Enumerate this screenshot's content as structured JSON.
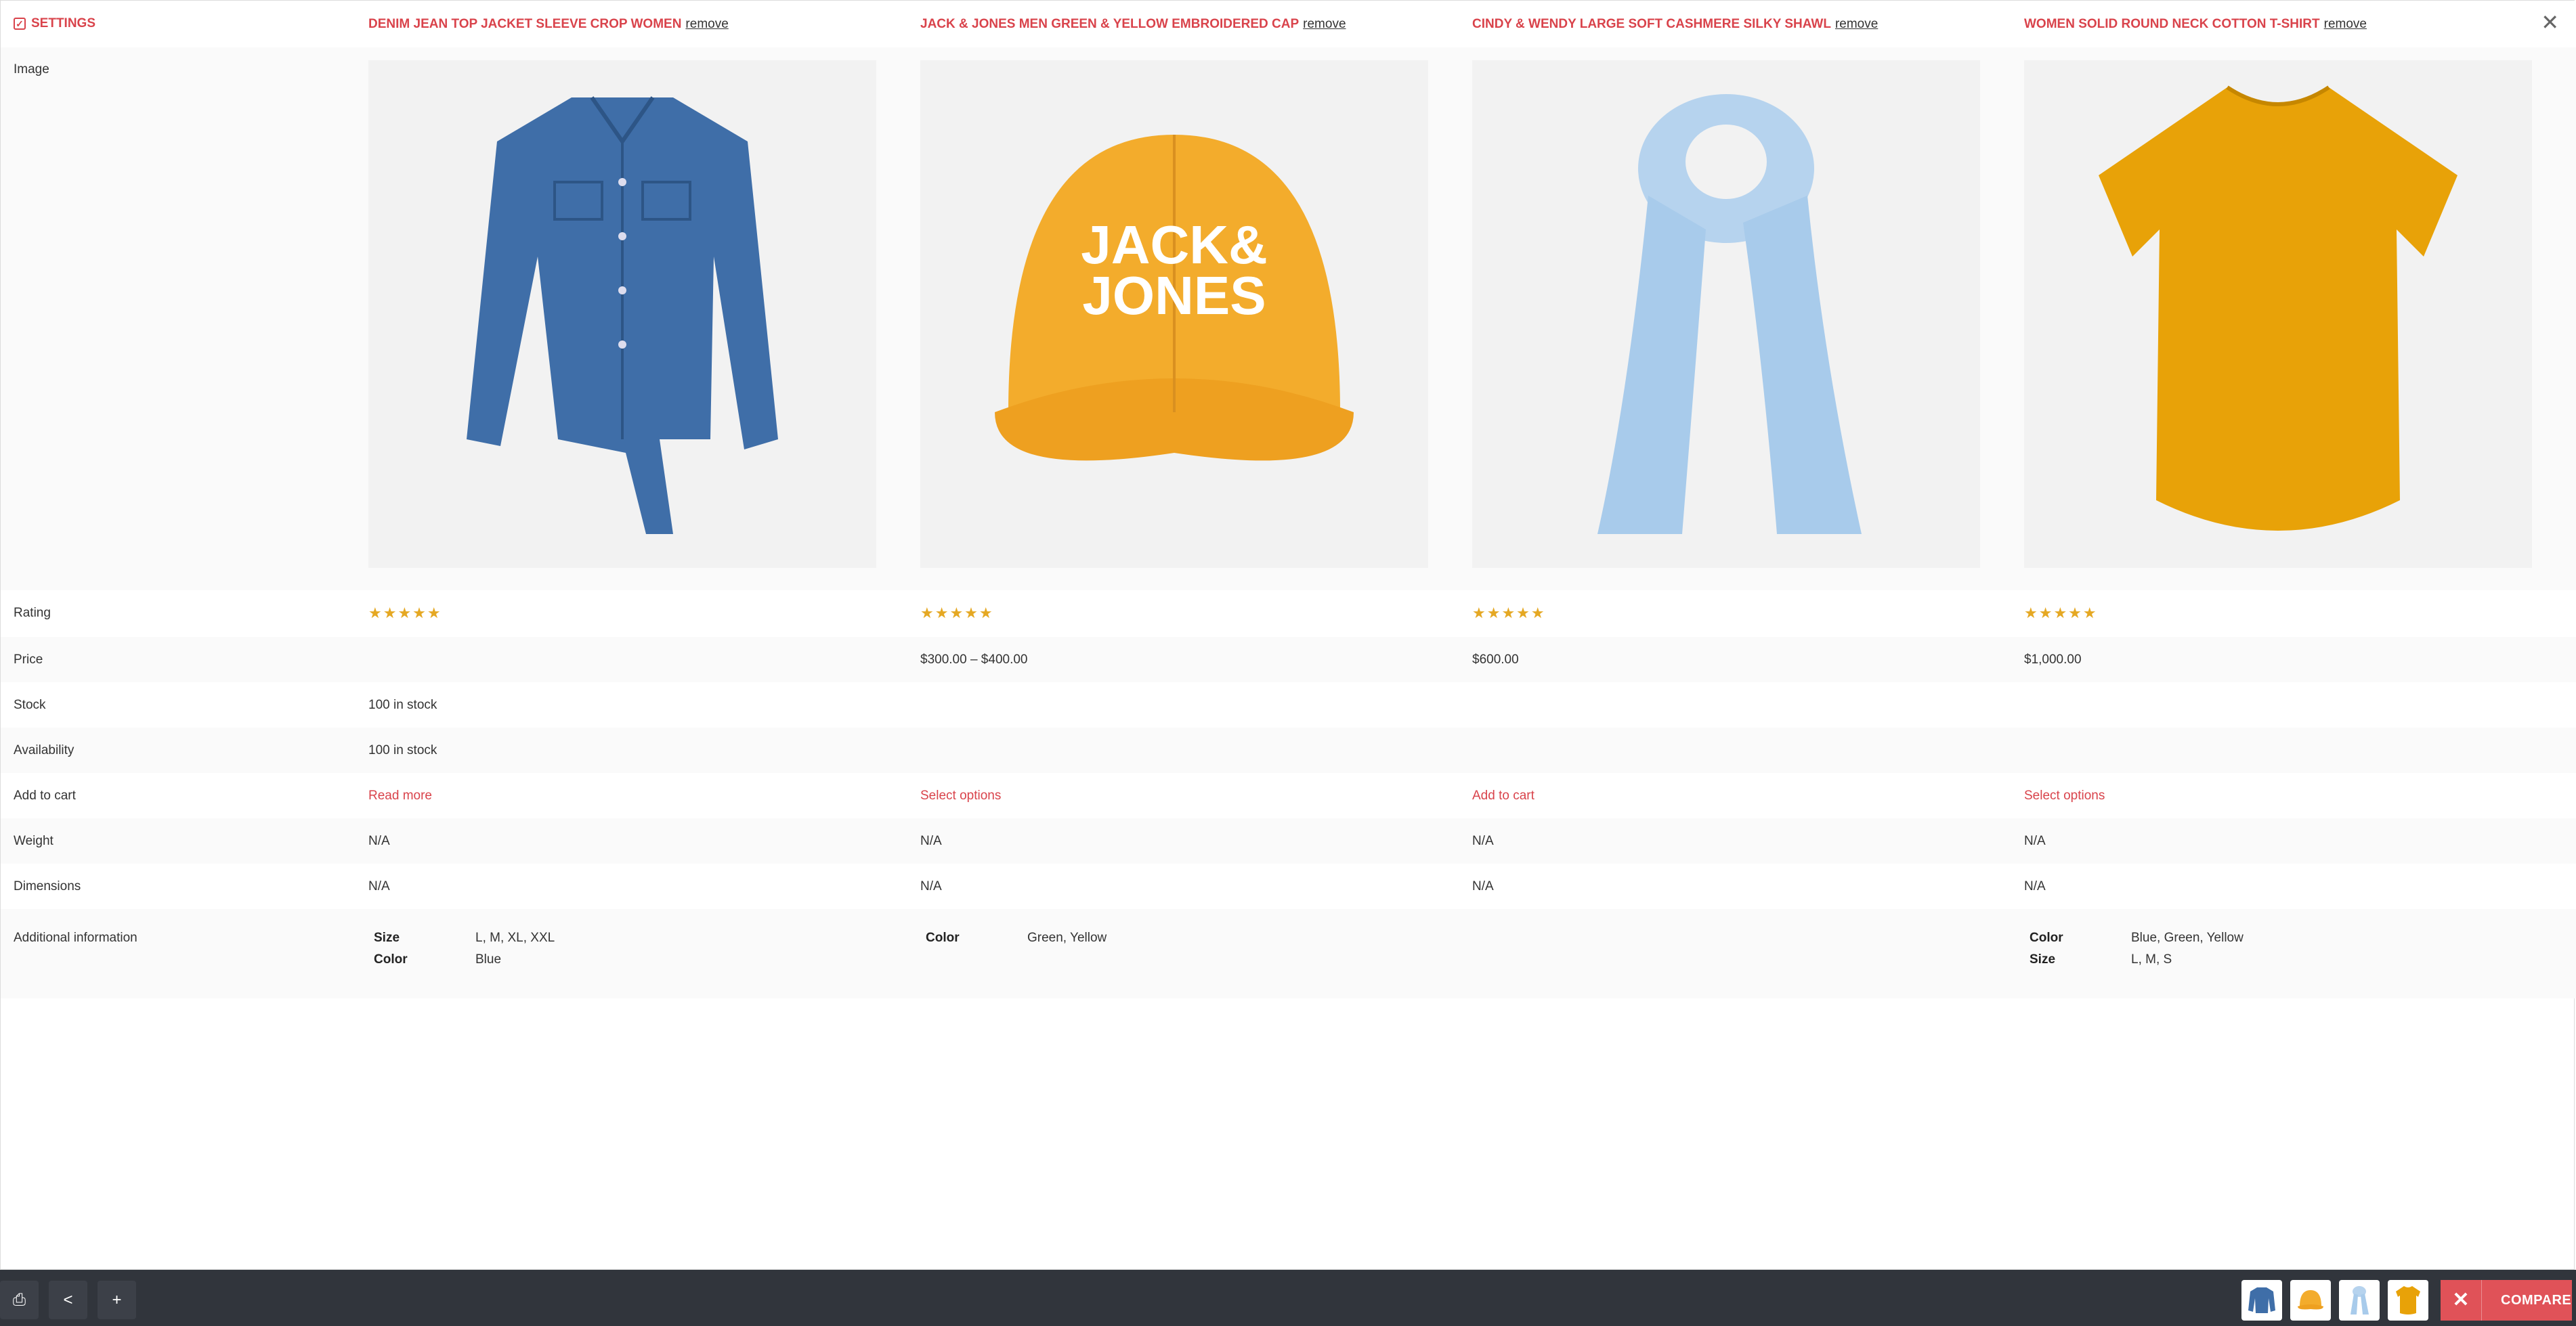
{
  "header": {
    "settings_label": "SETTINGS",
    "remove_label": "remove"
  },
  "products": [
    {
      "name": "DENIM JEAN TOP JACKET SLEEVE CROP WOMEN",
      "image": "denim-shirt-image",
      "price": "",
      "stock": "100 in stock",
      "availability": "100 in stock",
      "cart": "Read more",
      "weight": "N/A",
      "dimensions": "N/A",
      "attrs": [
        {
          "k": "Size",
          "v": "L, M, XL, XXL"
        },
        {
          "k": "Color",
          "v": "Blue"
        }
      ]
    },
    {
      "name": "JACK & JONES MEN GREEN & YELLOW EMBROIDERED CAP",
      "image": "yellow-cap-image",
      "price": "$300.00 – $400.00",
      "stock": "",
      "availability": "",
      "cart": "Select options",
      "weight": "N/A",
      "dimensions": "N/A",
      "attrs": [
        {
          "k": "Color",
          "v": "Green, Yellow"
        }
      ]
    },
    {
      "name": "CINDY & WENDY LARGE SOFT CASHMERE SILKY SHAWL",
      "image": "blue-shawl-image",
      "price": "$600.00",
      "stock": "",
      "availability": "",
      "cart": "Add to cart",
      "weight": "N/A",
      "dimensions": "N/A",
      "attrs": []
    },
    {
      "name": "WOMEN SOLID ROUND NECK COTTON T-SHIRT",
      "image": "yellow-tshirt-image",
      "price": "$1,000.00",
      "stock": "",
      "availability": "",
      "cart": "Select options",
      "weight": "N/A",
      "dimensions": "N/A",
      "attrs": [
        {
          "k": "Color",
          "v": "Blue, Green, Yellow"
        },
        {
          "k": "Size",
          "v": "L, M, S"
        }
      ]
    }
  ],
  "rows": {
    "image": "Image",
    "rating": "Rating",
    "price": "Price",
    "stock": "Stock",
    "availability": "Availability",
    "cart": "Add to cart",
    "weight": "Weight",
    "dimensions": "Dimensions",
    "additional": "Additional information"
  },
  "rating_stars": "★★★★★",
  "bottom": {
    "compare_label": "COMPARE",
    "icons": [
      "print-icon",
      "share-icon",
      "plus-icon"
    ]
  },
  "colors": {
    "accent": "#d9434b",
    "bar_bg": "#31353c",
    "compare_bg": "#e05258",
    "star": "#e5a823"
  }
}
